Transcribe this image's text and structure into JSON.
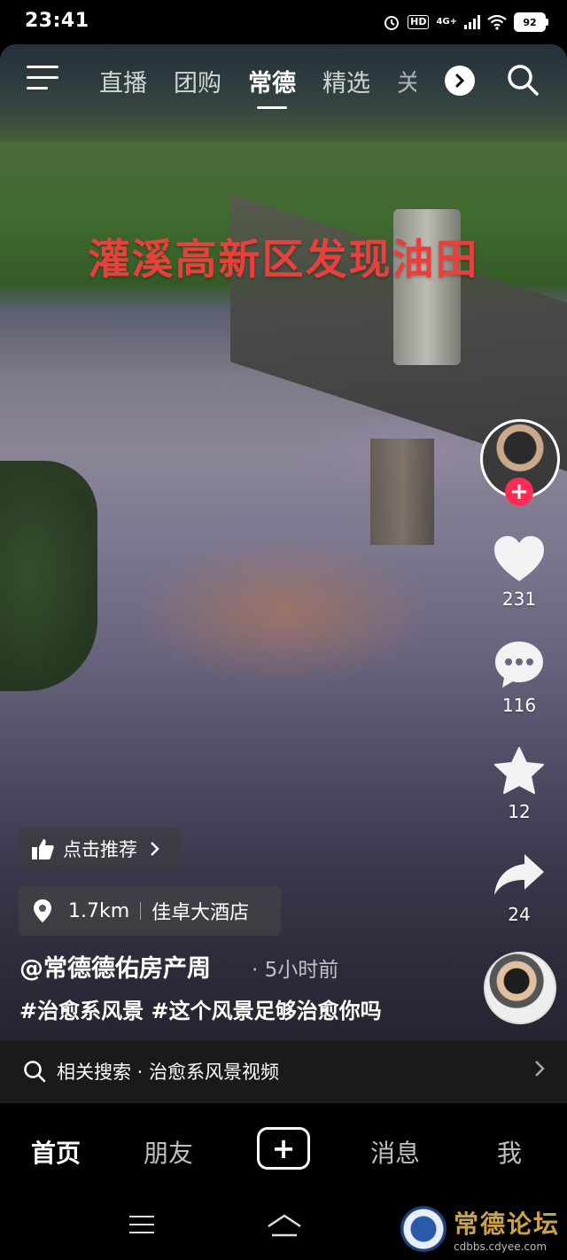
{
  "status_bar": {
    "time": "23:41",
    "hd": "HD",
    "network": "4G+",
    "battery": "92"
  },
  "top_nav": {
    "tabs": [
      {
        "label": "直播"
      },
      {
        "label": "团购"
      },
      {
        "label": "常德",
        "active": true
      },
      {
        "label": "精选"
      },
      {
        "label": "关"
      }
    ]
  },
  "video": {
    "headline": "灌溪高新区发现油田"
  },
  "right_rail": {
    "like_count": "231",
    "comment_count": "116",
    "favorite_count": "12",
    "share_count": "24",
    "follow_symbol": "+"
  },
  "info": {
    "recommend_label": "点击推荐",
    "distance": "1.7km",
    "place": "佳卓大酒店",
    "author": "@常德德佑房产周",
    "post_time": "5小时前",
    "caption": "#治愈系风景 #这个风景足够治愈你吗",
    "related_search": "相关搜索 · 治愈系风景视频"
  },
  "bottom_tabs": {
    "home": "首页",
    "friends": "朋友",
    "post": "+",
    "messages": "消息",
    "me": "我"
  },
  "watermark": {
    "name": "常德论坛",
    "url": "cdbbs.cdyee.com"
  },
  "colors": {
    "headline": "#e8403b",
    "follow": "#fe2c55"
  }
}
